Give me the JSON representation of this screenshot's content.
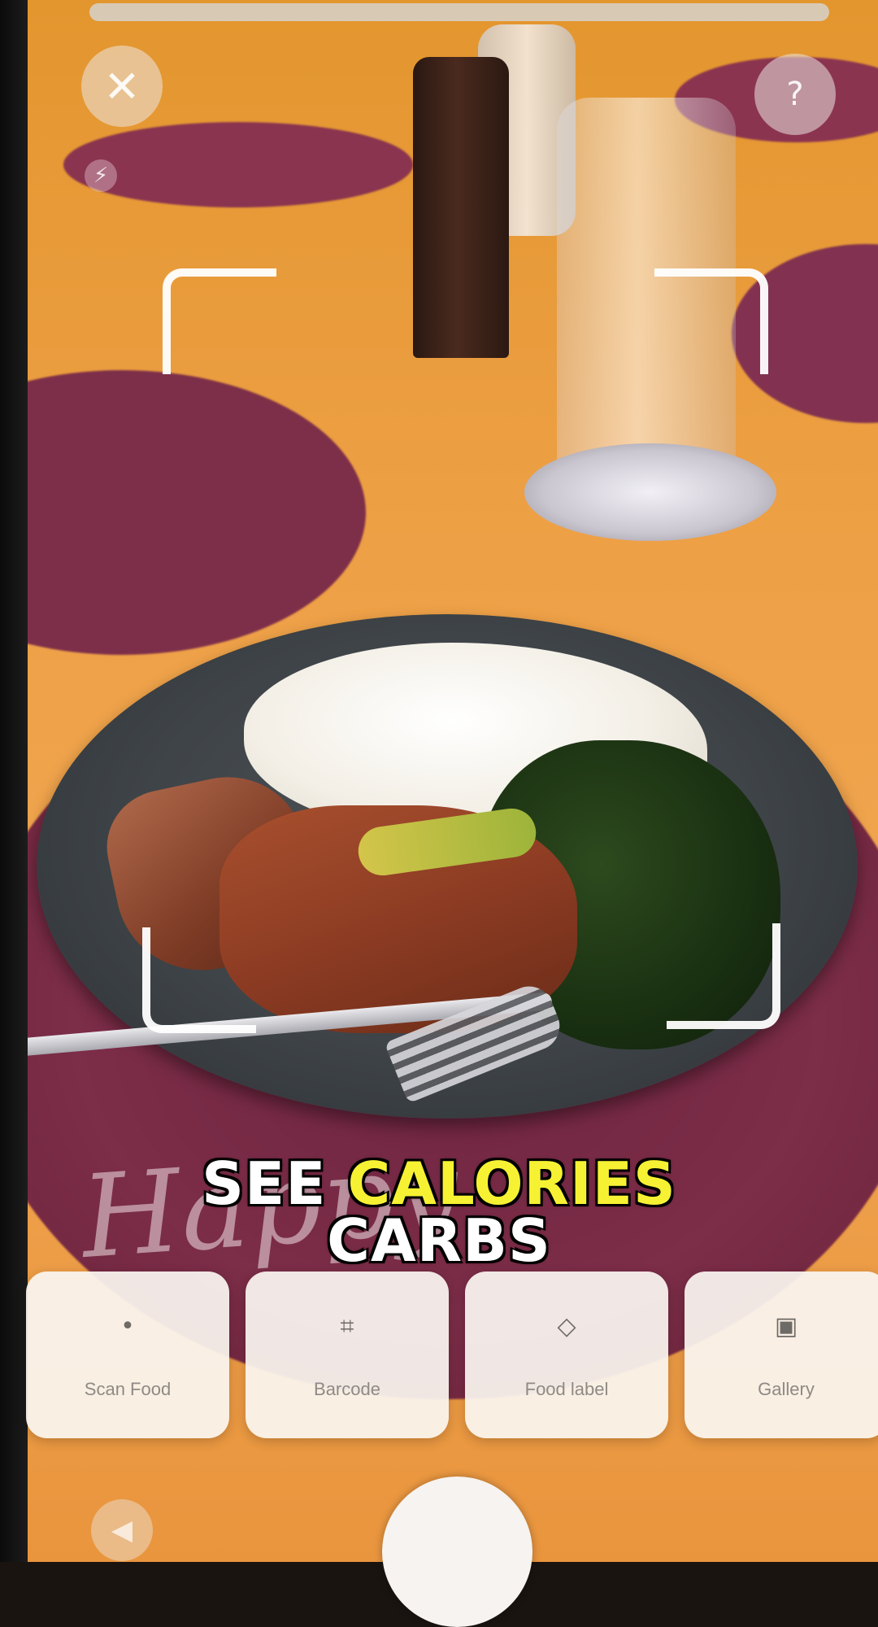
{
  "camera": {
    "close_glyph": "✕",
    "help_glyph": "?",
    "flash_glyph": "⚡",
    "back_glyph": "◀"
  },
  "caption": {
    "line1_word1": "SEE",
    "line1_word2": "CALORIES",
    "line2": "CARBS",
    "colors": {
      "white": "#ffffff",
      "highlight": "#f6f233"
    }
  },
  "modes": [
    {
      "label": "Scan Food",
      "icon": "dot-icon",
      "glyph": "•"
    },
    {
      "label": "Barcode",
      "icon": "barcode-icon",
      "glyph": "⌗"
    },
    {
      "label": "Food label",
      "icon": "tag-icon",
      "glyph": "◇"
    },
    {
      "label": "Gallery",
      "icon": "image-icon",
      "glyph": "▣"
    }
  ],
  "scene": {
    "plate_script_text": "Happy"
  }
}
